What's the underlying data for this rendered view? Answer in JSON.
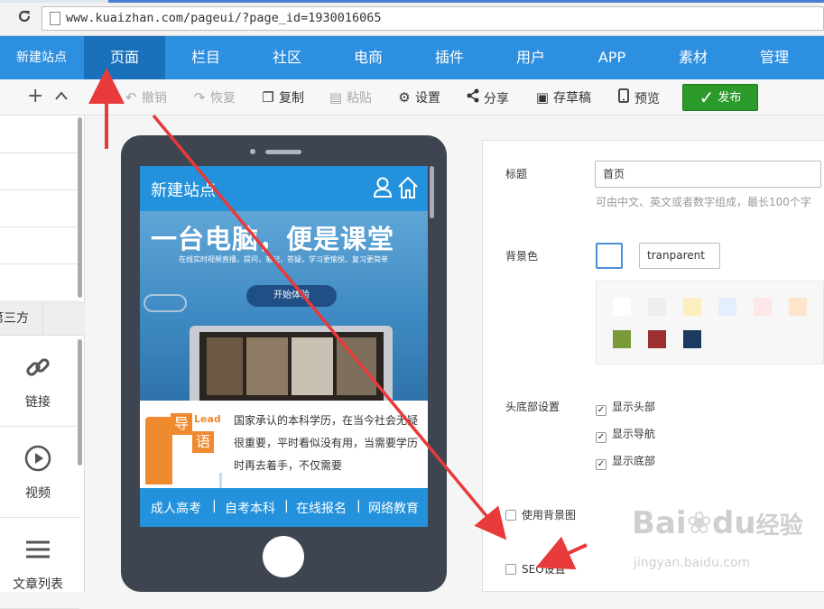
{
  "browser": {
    "url": "www.kuaizhan.com/pageui/?page_id=1930016065"
  },
  "main_nav": {
    "site_name": "新建站点",
    "items": [
      "页面",
      "栏目",
      "社区",
      "电商",
      "插件",
      "用户",
      "APP",
      "素材",
      "管理"
    ],
    "active": "页面"
  },
  "left_panel": {
    "tab_label": "第三方",
    "widgets": [
      {
        "label": "链接",
        "icon": "link-icon"
      },
      {
        "label": "视频",
        "icon": "play-circle-icon"
      },
      {
        "label": "文章列表",
        "icon": "list-icon"
      }
    ]
  },
  "toolbar": {
    "undo": "撤销",
    "redo": "恢复",
    "copy": "复制",
    "paste": "粘贴",
    "settings": "设置",
    "share": "分享",
    "save_draft": "存草稿",
    "preview": "预览",
    "publish": "发布"
  },
  "phone": {
    "header_title": "新建站点",
    "banner_headline": "一台电脑，便是课堂",
    "banner_subtitle": "在线实时视频直播，提问，笔记，答疑，学习更愉悦，复习更简单",
    "banner_cta": "开始体验",
    "logo_chars": [
      "导",
      "语"
    ],
    "logo_lead": "Lead",
    "article_text": "国家承认的本科学历，在当今社会无疑很重要，平时看似没有用，当需要学历 时再去着手，不仅需要",
    "footer_links": [
      "成人高考",
      "自考本科",
      "在线报名",
      "网络教育"
    ],
    "footer_separator": "|"
  },
  "settings": {
    "title_label": "标题",
    "title_value": "首页",
    "title_hint": "可由中文、英文或者数字组成，最长100个字",
    "bg_color_label": "背景色",
    "bg_color_value": "tranparent",
    "palette_colors": [
      "#ffffff",
      "#eeeeee",
      "#fbefc0",
      "#e3effc",
      "#fde7e7",
      "#fde5cc",
      "#7a9a3a",
      "#9c3030",
      "#1c3a60"
    ],
    "header_footer_label": "头底部设置",
    "checkboxes": [
      {
        "label": "显示头部",
        "checked": true
      },
      {
        "label": "显示导航",
        "checked": true
      },
      {
        "label": "显示底部",
        "checked": true
      }
    ],
    "use_bg_image": "使用背景图",
    "seo": "SEO设置"
  },
  "watermark": {
    "brand": "Bai",
    "brand_paw": "du",
    "brand_cn": "经验",
    "site": "jingyan.baidu.com"
  },
  "colors": {
    "nav_blue": "#2d8fe0",
    "nav_active": "#1a70bb",
    "publish_green": "#2b9a2b",
    "annotation_red": "#e83a3a"
  }
}
